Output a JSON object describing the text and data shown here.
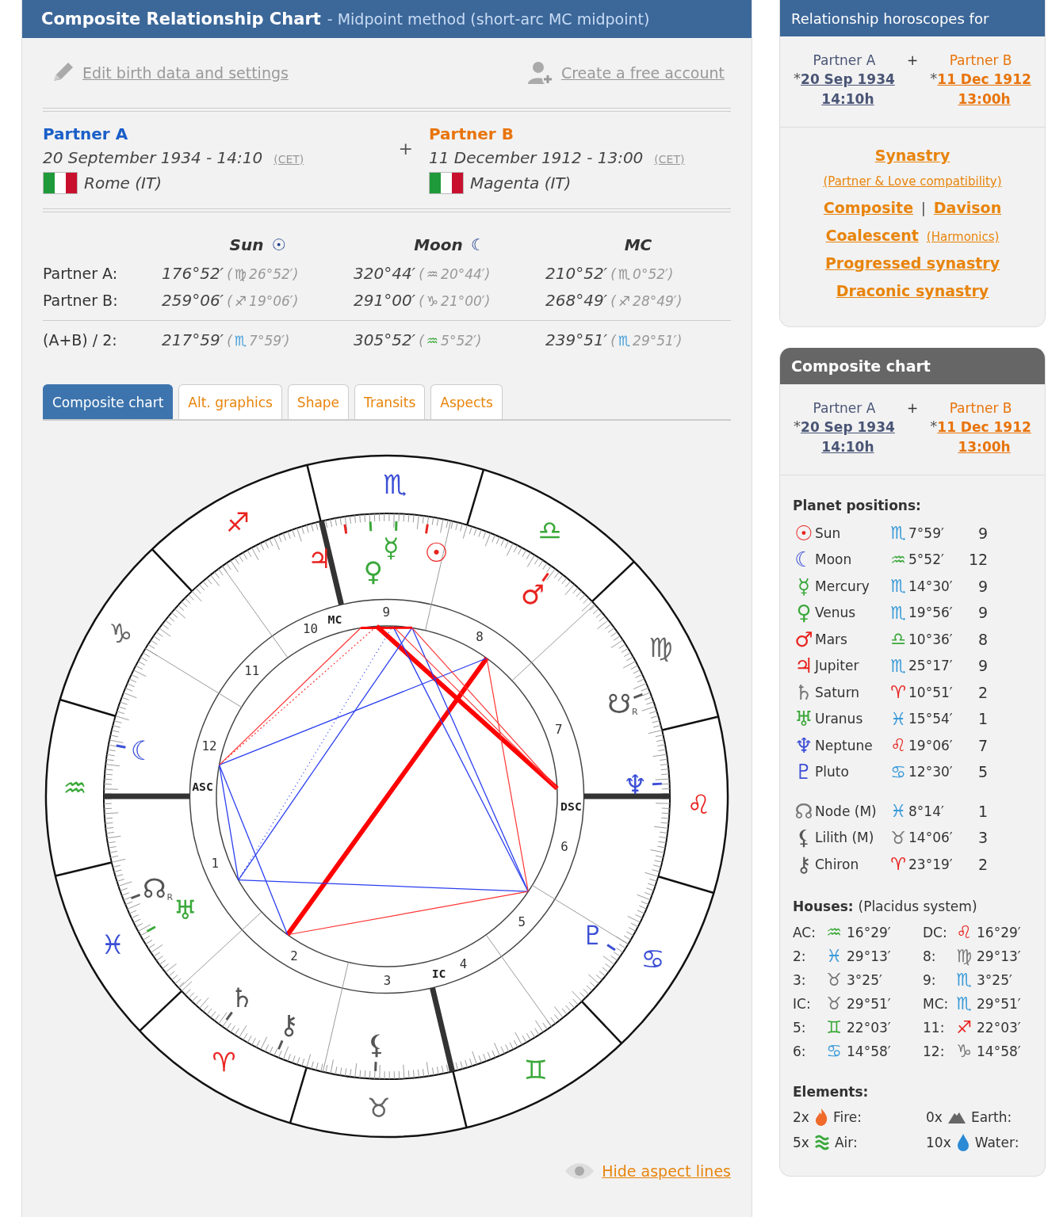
{
  "main": {
    "title": "Composite Relationship Chart",
    "subtitle": "- Midpoint method (short-arc MC midpoint)",
    "links": [
      {
        "text": "Edit birth data and settings",
        "kind": "edit"
      },
      {
        "text": "Create a free account",
        "kind": "account"
      }
    ],
    "partners": [
      {
        "name": "Partner A",
        "kind": "a",
        "date": "20 September 1934 - 14:10",
        "zone": "(CET)",
        "place": "Rome (IT)"
      },
      {
        "name": "Partner B",
        "kind": "b",
        "date": "11 December 1912 - 13:00",
        "zone": "(CET)",
        "place": "Magenta (IT)"
      }
    ],
    "plus": "+",
    "table": {
      "columns": [
        {
          "label": "Sun",
          "glyph": "☉"
        },
        {
          "label": "Moon",
          "glyph": "☾"
        },
        {
          "label": "MC"
        }
      ],
      "rows": [
        {
          "label": "Partner A:",
          "cells": [
            {
              "value": "176°52′",
              "open": "(",
              "sign": "♍",
              "rest": "26°52′)",
              "color": "#8a8a8a"
            },
            {
              "value": "320°44′",
              "open": "(",
              "sign": "♒",
              "rest": "20°44′)",
              "color": "#8a8a8a"
            },
            {
              "value": "210°52′",
              "open": "(",
              "sign": "♏",
              "rest": "0°52′)",
              "color": "#8a8a8a"
            }
          ]
        },
        {
          "label": "Partner B:",
          "cells": [
            {
              "value": "259°06′",
              "open": "(",
              "sign": "♐",
              "rest": "19°06′)",
              "color": "#8a8a8a"
            },
            {
              "value": "291°00′",
              "open": "(",
              "sign": "♑",
              "rest": "21°00′)",
              "color": "#8a8a8a"
            },
            {
              "value": "268°49′",
              "open": "(",
              "sign": "♐",
              "rest": "28°49′)",
              "color": "#8a8a8a"
            }
          ]
        },
        {
          "label": "(A+B) / 2:",
          "cells": [
            {
              "value": "217°59′",
              "open": "(",
              "sign": "♏",
              "rest": "7°59′)",
              "color": "#3a9ad9"
            },
            {
              "value": "305°52′",
              "open": "(",
              "sign": "♒",
              "rest": "5°52′)",
              "color": "#3aa83a"
            },
            {
              "value": "239°51′",
              "open": "(",
              "sign": "♏",
              "rest": "29°51′)",
              "color": "#3a9ad9"
            }
          ]
        }
      ]
    },
    "tabs": [
      {
        "label": "Composite chart",
        "selected": true
      },
      {
        "label": "Alt. graphics",
        "selected": false
      },
      {
        "label": "Shape",
        "selected": false
      },
      {
        "label": "Transits",
        "selected": false
      },
      {
        "label": "Aspects",
        "selected": false
      }
    ],
    "wheel": {
      "signs": [
        {
          "glyph": "♈",
          "color": "#e8231f"
        },
        {
          "glyph": "♉",
          "color": "#666666"
        },
        {
          "glyph": "♊",
          "color": "#3aa83a"
        },
        {
          "glyph": "♋",
          "color": "#3c4fd6"
        },
        {
          "glyph": "♌",
          "color": "#e8231f"
        },
        {
          "glyph": "♍",
          "color": "#666666"
        },
        {
          "glyph": "♎",
          "color": "#3aa83a"
        },
        {
          "glyph": "♏",
          "color": "#3c4fd6"
        },
        {
          "glyph": "♐",
          "color": "#e8231f"
        },
        {
          "glyph": "♑",
          "color": "#666666"
        },
        {
          "glyph": "♒",
          "color": "#3aa83a"
        },
        {
          "glyph": "♓",
          "color": "#3c4fd6"
        }
      ],
      "house_numbers": [
        "1",
        "2",
        "3",
        "4",
        "5",
        "6",
        "7",
        "8",
        "9",
        "10",
        "11",
        "12"
      ],
      "angles": [
        "ASC",
        "IC",
        "DSC",
        "MC"
      ],
      "planets": [
        {
          "glyph": "☉",
          "color": "#e8231f"
        },
        {
          "glyph": "☾",
          "color": "#3c4fd6"
        },
        {
          "glyph": "☿",
          "color": "#3aa83a"
        },
        {
          "glyph": "♀",
          "color": "#3aa83a"
        },
        {
          "glyph": "♂",
          "color": "#e8231f"
        },
        {
          "glyph": "♃",
          "color": "#e8231f"
        },
        {
          "glyph": "♄",
          "color": "#555555"
        },
        {
          "glyph": "♅",
          "color": "#3aa83a"
        },
        {
          "glyph": "♆",
          "color": "#3c4fd6"
        },
        {
          "glyph": "♇",
          "color": "#3c4fd6"
        },
        {
          "glyph": "☊",
          "color": "#555555",
          "retro": "R"
        },
        {
          "glyph": "⚸",
          "color": "#555555"
        },
        {
          "glyph": "⚷",
          "color": "#555555"
        },
        {
          "glyph": "☋",
          "color": "#555555",
          "retro": "R"
        }
      ]
    },
    "hide_link": "Hide aspect lines"
  },
  "side": {
    "title": "Relationship horoscopes for",
    "partners": [
      {
        "name": "Partner A",
        "kind": "a",
        "star": "*",
        "date": "20 Sep 1934",
        "time": "14:10h"
      },
      {
        "name": "Partner B",
        "kind": "b",
        "star": "*",
        "date": "11 Dec 1912",
        "time": "13:00h"
      }
    ],
    "plus": "+",
    "link_rows": [
      [
        {
          "text": "Synastry",
          "kind": "main"
        }
      ],
      [
        {
          "text": "(Partner & Love compatibility)",
          "kind": "sub"
        }
      ],
      [
        {
          "text": "Composite",
          "kind": "main"
        },
        {
          "text": "|",
          "kind": "separator"
        },
        {
          "text": "Davison",
          "kind": "main"
        }
      ],
      [
        {
          "text": "Coalescent",
          "kind": "main"
        },
        {
          "text": "(Harmonics)",
          "kind": "sub"
        }
      ],
      [
        {
          "text": "Progressed synastry",
          "kind": "main"
        }
      ],
      [
        {
          "text": "Draconic synastry",
          "kind": "main"
        }
      ]
    ]
  },
  "composite": {
    "title": "Composite chart",
    "partners": [
      {
        "name": "Partner A",
        "kind": "a",
        "star": "*",
        "date": "20 Sep 1934",
        "time": "14:10h"
      },
      {
        "name": "Partner B",
        "kind": "b",
        "star": "*",
        "date": "11 Dec 1912",
        "time": "13:00h"
      }
    ],
    "plus": "+",
    "planets_title": "Planet positions:",
    "planets": [
      {
        "glyph": "☉",
        "color": "#e8231f",
        "name": "Sun",
        "sign": {
          "glyph": "♏",
          "color": "#3a9ad9"
        },
        "degree": "7°59′",
        "house": "9"
      },
      {
        "glyph": "☾",
        "color": "#3c4fd6",
        "name": "Moon",
        "sign": {
          "glyph": "♒",
          "color": "#3aa83a"
        },
        "degree": "5°52′",
        "house": "12"
      },
      {
        "glyph": "☿",
        "color": "#3aa83a",
        "name": "Mercury",
        "sign": {
          "glyph": "♏",
          "color": "#3a9ad9"
        },
        "degree": "14°30′",
        "house": "9"
      },
      {
        "glyph": "♀",
        "color": "#3aa83a",
        "name": "Venus",
        "sign": {
          "glyph": "♏",
          "color": "#3a9ad9"
        },
        "degree": "19°56′",
        "house": "9"
      },
      {
        "glyph": "♂",
        "color": "#e8231f",
        "name": "Mars",
        "sign": {
          "glyph": "♎",
          "color": "#3aa83a"
        },
        "degree": "10°36′",
        "house": "8"
      },
      {
        "glyph": "♃",
        "color": "#e8231f",
        "name": "Jupiter",
        "sign": {
          "glyph": "♏",
          "color": "#3a9ad9"
        },
        "degree": "25°17′",
        "house": "9"
      },
      {
        "glyph": "♄",
        "color": "#777777",
        "name": "Saturn",
        "sign": {
          "glyph": "♈",
          "color": "#e8231f"
        },
        "degree": "10°51′",
        "house": "2"
      },
      {
        "glyph": "♅",
        "color": "#3aa83a",
        "name": "Uranus",
        "sign": {
          "glyph": "♓",
          "color": "#3a9ad9"
        },
        "degree": "15°54′",
        "house": "1"
      },
      {
        "glyph": "♆",
        "color": "#3c4fd6",
        "name": "Neptune",
        "sign": {
          "glyph": "♌",
          "color": "#e8231f"
        },
        "degree": "19°06′",
        "house": "7"
      },
      {
        "glyph": "♇",
        "color": "#3c4fd6",
        "name": "Pluto",
        "sign": {
          "glyph": "♋",
          "color": "#3a9ad9"
        },
        "degree": "12°30′",
        "house": "5"
      }
    ],
    "points": [
      {
        "glyph": "☊",
        "color": "#777777",
        "name": "Node (M)",
        "sign": {
          "glyph": "♓",
          "color": "#3a9ad9"
        },
        "degree": "8°14′",
        "house": "1"
      },
      {
        "glyph": "⚸",
        "color": "#555555",
        "name": "Lilith (M)",
        "sign": {
          "glyph": "♉",
          "color": "#777777"
        },
        "degree": "14°06′",
        "house": "3"
      },
      {
        "glyph": "⚷",
        "color": "#555555",
        "name": "Chiron",
        "sign": {
          "glyph": "♈",
          "color": "#e8231f"
        },
        "degree": "23°19′",
        "house": "2"
      }
    ],
    "houses_title": "Houses:",
    "houses_note": "(Placidus system)",
    "houses": [
      {
        "label": "AC:",
        "sign": {
          "glyph": "♒",
          "color": "#3aa83a"
        },
        "degree": "16°29′"
      },
      {
        "label": "DC:",
        "sign": {
          "glyph": "♌",
          "color": "#e8231f"
        },
        "degree": "16°29′"
      },
      {
        "label": "2:",
        "sign": {
          "glyph": "♓",
          "color": "#3a9ad9"
        },
        "degree": "29°13′"
      },
      {
        "label": "8:",
        "sign": {
          "glyph": "♍",
          "color": "#777777"
        },
        "degree": "29°13′"
      },
      {
        "label": "3:",
        "sign": {
          "glyph": "♉",
          "color": "#777777"
        },
        "degree": "3°25′"
      },
      {
        "label": "9:",
        "sign": {
          "glyph": "♏",
          "color": "#3a9ad9"
        },
        "degree": "3°25′"
      },
      {
        "label": "IC:",
        "sign": {
          "glyph": "♉",
          "color": "#777777"
        },
        "degree": "29°51′"
      },
      {
        "label": "MC:",
        "sign": {
          "glyph": "♏",
          "color": "#3a9ad9"
        },
        "degree": "29°51′"
      },
      {
        "label": "5:",
        "sign": {
          "glyph": "♊",
          "color": "#3aa83a"
        },
        "degree": "22°03′"
      },
      {
        "label": "11:",
        "sign": {
          "glyph": "♐",
          "color": "#e8231f"
        },
        "degree": "22°03′"
      },
      {
        "label": "6:",
        "sign": {
          "glyph": "♋",
          "color": "#3a9ad9"
        },
        "degree": "14°58′"
      },
      {
        "label": "12:",
        "sign": {
          "glyph": "♑",
          "color": "#777777"
        },
        "degree": "14°58′"
      }
    ],
    "elements_title": "Elements:",
    "elements": [
      {
        "count": "2x",
        "kind": "fire",
        "label": "Fire:"
      },
      {
        "count": "0x",
        "kind": "earth",
        "label": "Earth:"
      },
      {
        "count": "5x",
        "kind": "air",
        "label": "Air:"
      },
      {
        "count": "10x",
        "kind": "water",
        "label": "Water:"
      }
    ]
  }
}
